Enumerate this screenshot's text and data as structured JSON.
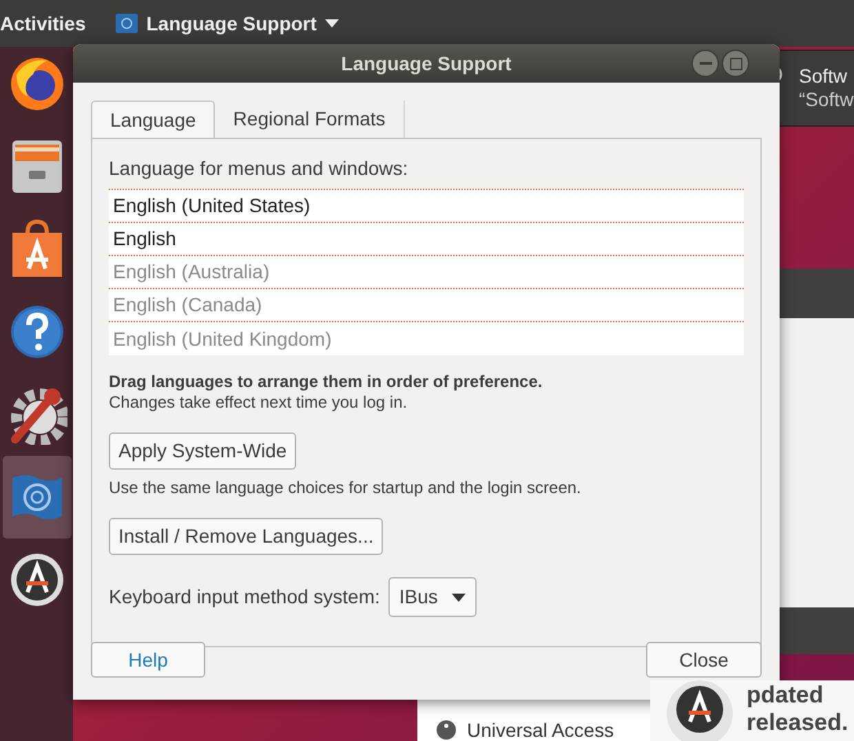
{
  "top_bar": {
    "activities": "Activities",
    "app_menu": "Language Support"
  },
  "dock": {
    "items": [
      {
        "kind": "browser",
        "selected": false
      },
      {
        "kind": "files",
        "selected": false
      },
      {
        "kind": "software",
        "selected": false
      },
      {
        "kind": "help",
        "selected": false
      },
      {
        "kind": "settings",
        "selected": false
      },
      {
        "kind": "language",
        "selected": true
      },
      {
        "kind": "updater",
        "selected": false
      }
    ]
  },
  "notification": {
    "title": "Softw",
    "body": "“Softw"
  },
  "background_window": {
    "sidebar_item": "Universal Access",
    "message_line_1": "pdated",
    "message_line_2": "released."
  },
  "dialog": {
    "title": "Language Support",
    "tabs": [
      {
        "label": "Language",
        "selected": true
      },
      {
        "label": "Regional Formats",
        "selected": false
      }
    ],
    "list_label": "Language for menus and windows:",
    "languages": [
      {
        "name": "English (United States)",
        "disabled": false
      },
      {
        "name": "English",
        "disabled": false
      },
      {
        "name": "English (Australia)",
        "disabled": true
      },
      {
        "name": "English (Canada)",
        "disabled": true
      },
      {
        "name": "English (United Kingdom)",
        "disabled": true
      }
    ],
    "hint_bold": "Drag languages to arrange them in order of preference.",
    "hint": "Changes take effect next time you log in.",
    "apply_button": "Apply System-Wide",
    "apply_note": "Use the same language choices for startup and the login screen.",
    "install_button": "Install / Remove Languages...",
    "keyboard_label": "Keyboard input method system:",
    "keyboard_value": "IBus",
    "help_button": "Help",
    "close_button": "Close"
  }
}
